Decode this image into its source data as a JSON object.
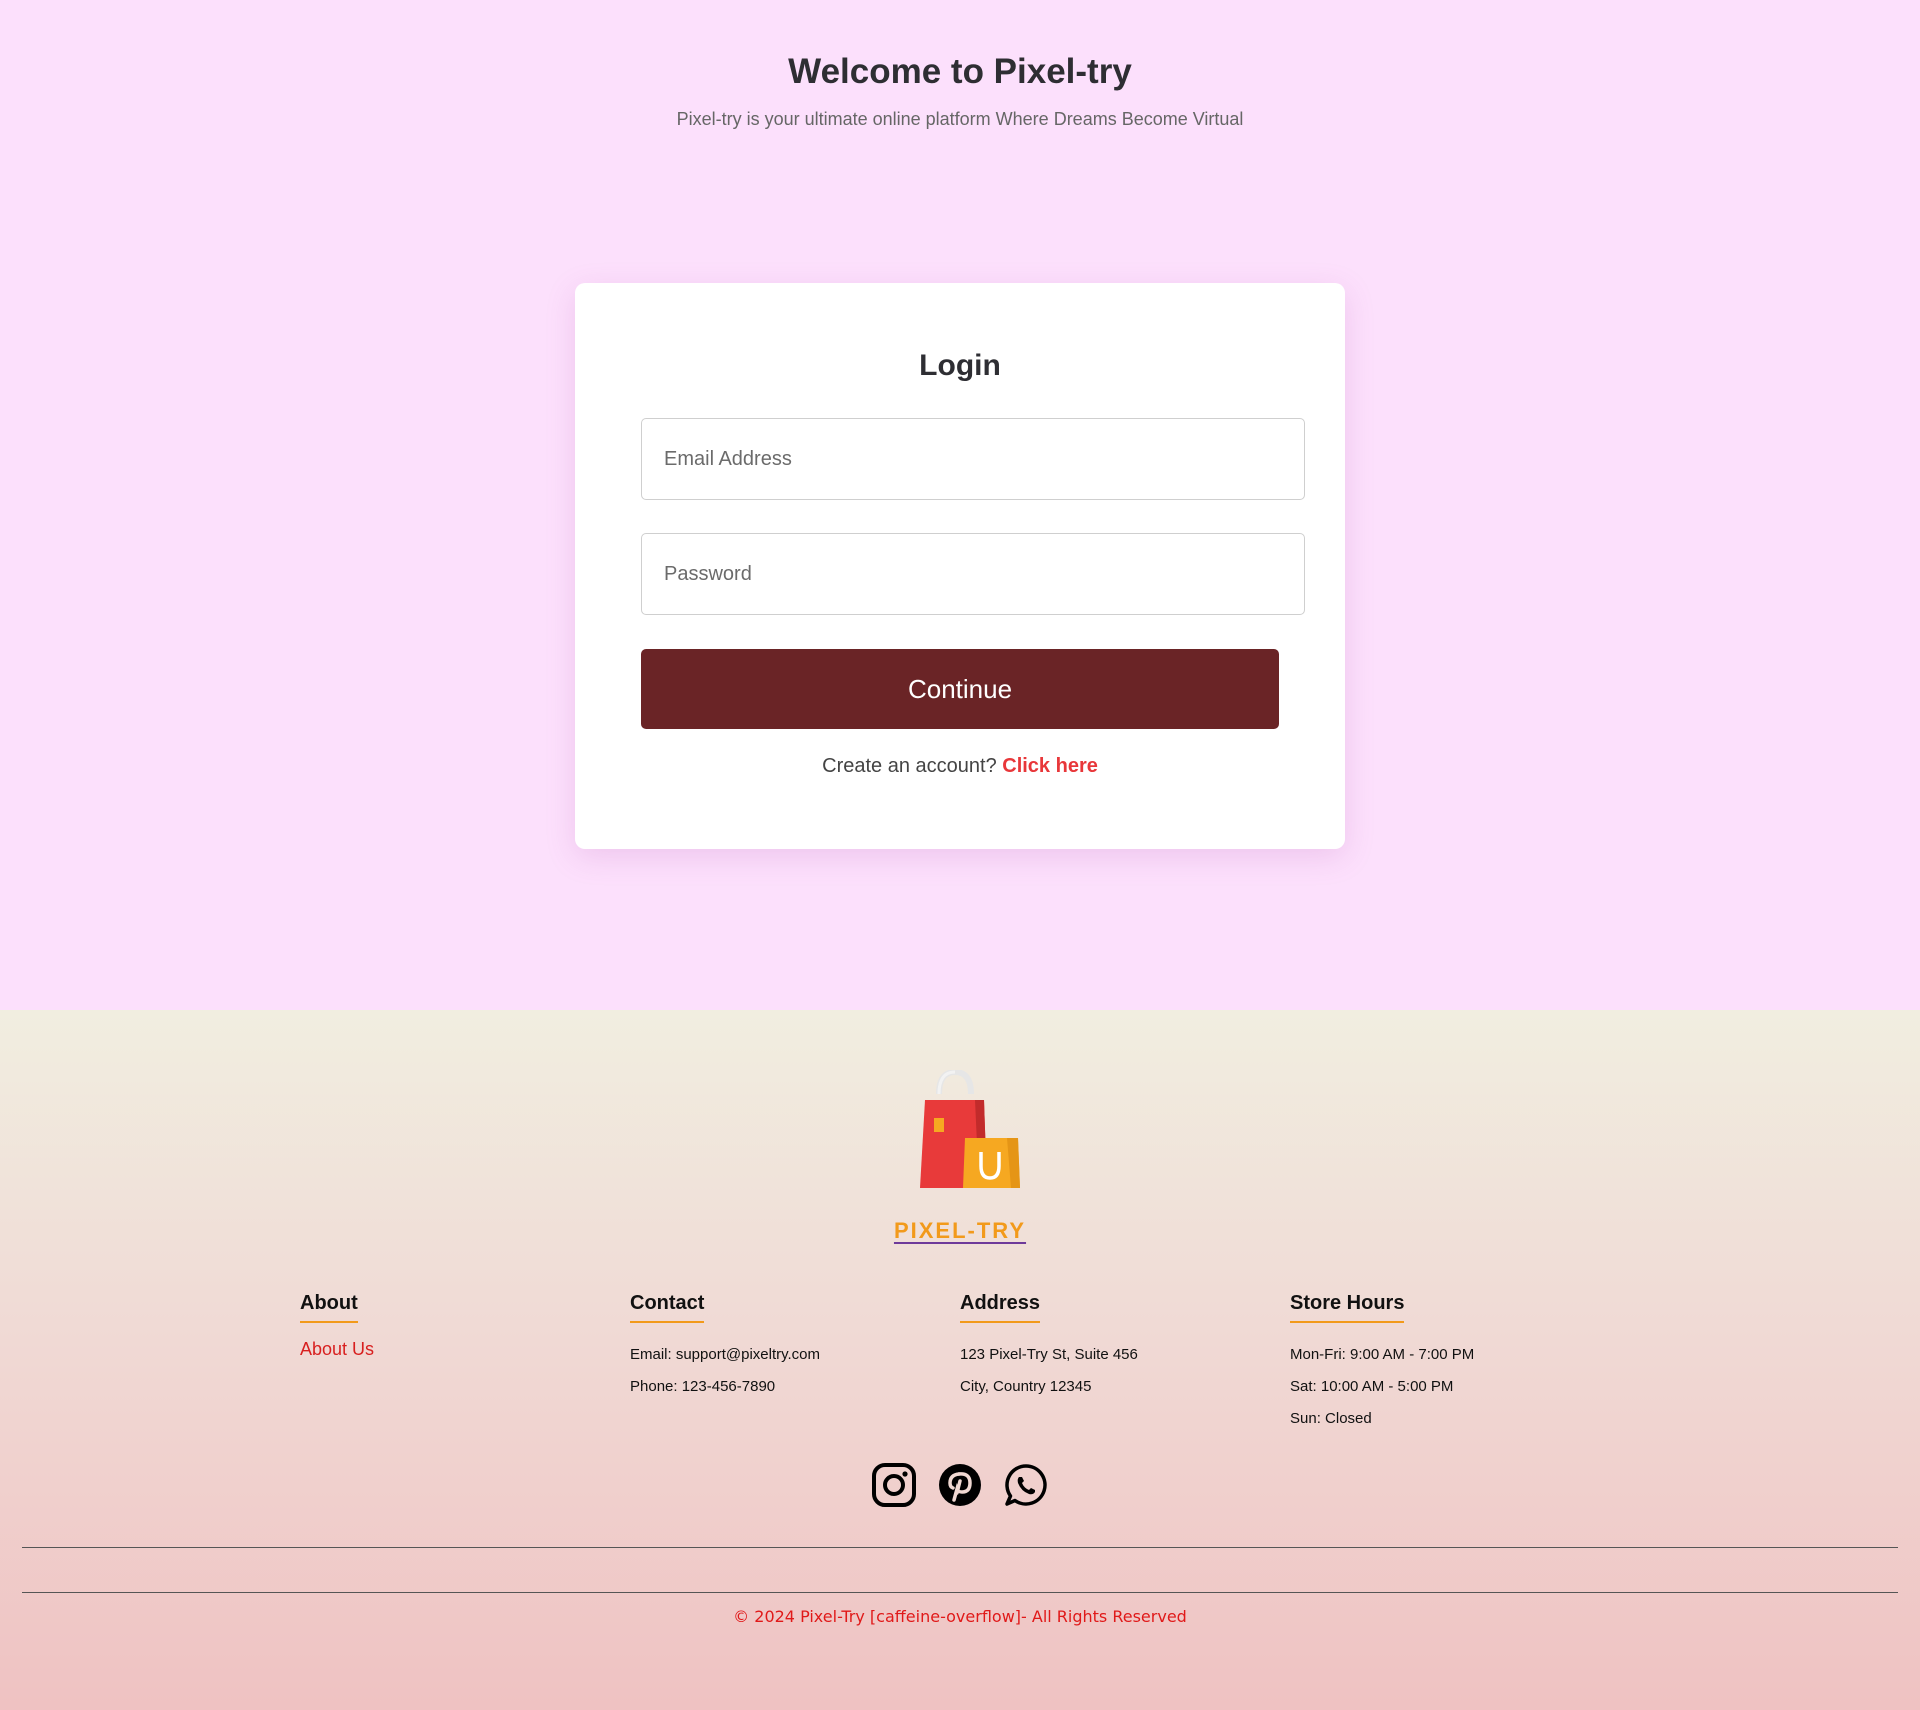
{
  "hero": {
    "title": "Welcome to Pixel-try",
    "subtitle": "Pixel-try is your ultimate online platform Where Dreams Become Virtual"
  },
  "login": {
    "title": "Login",
    "email_placeholder": "Email Address",
    "password_placeholder": "Password",
    "continue_label": "Continue",
    "signup_prompt": "Create an account?",
    "signup_link": "Click here"
  },
  "footer": {
    "brand": "PIXEL-TRY",
    "logo_icon": "shopping-bags-icon",
    "about": {
      "heading": "About",
      "link": "About Us"
    },
    "contact": {
      "heading": "Contact",
      "email": "Email: support@pixeltry.com",
      "phone": "Phone: 123-456-7890"
    },
    "address": {
      "heading": "Address",
      "line1": "123 Pixel-Try St, Suite 456",
      "line2": "City, Country 12345"
    },
    "hours": {
      "heading": "Store Hours",
      "weekday": "Mon-Fri: 9:00 AM - 7:00 PM",
      "saturday": "Sat: 10:00 AM - 5:00 PM",
      "sunday": "Sun: Closed"
    },
    "socials": [
      "instagram-icon",
      "pinterest-icon",
      "whatsapp-icon"
    ],
    "copyright": "© 2024 Pixel-Try [caffeine-overflow]- All Rights Reserved"
  },
  "colors": {
    "page_bg": "#fce0fc",
    "continue_button": "#6a2426",
    "link_red": "#e8373a",
    "brand_orange": "#f29a1b"
  }
}
